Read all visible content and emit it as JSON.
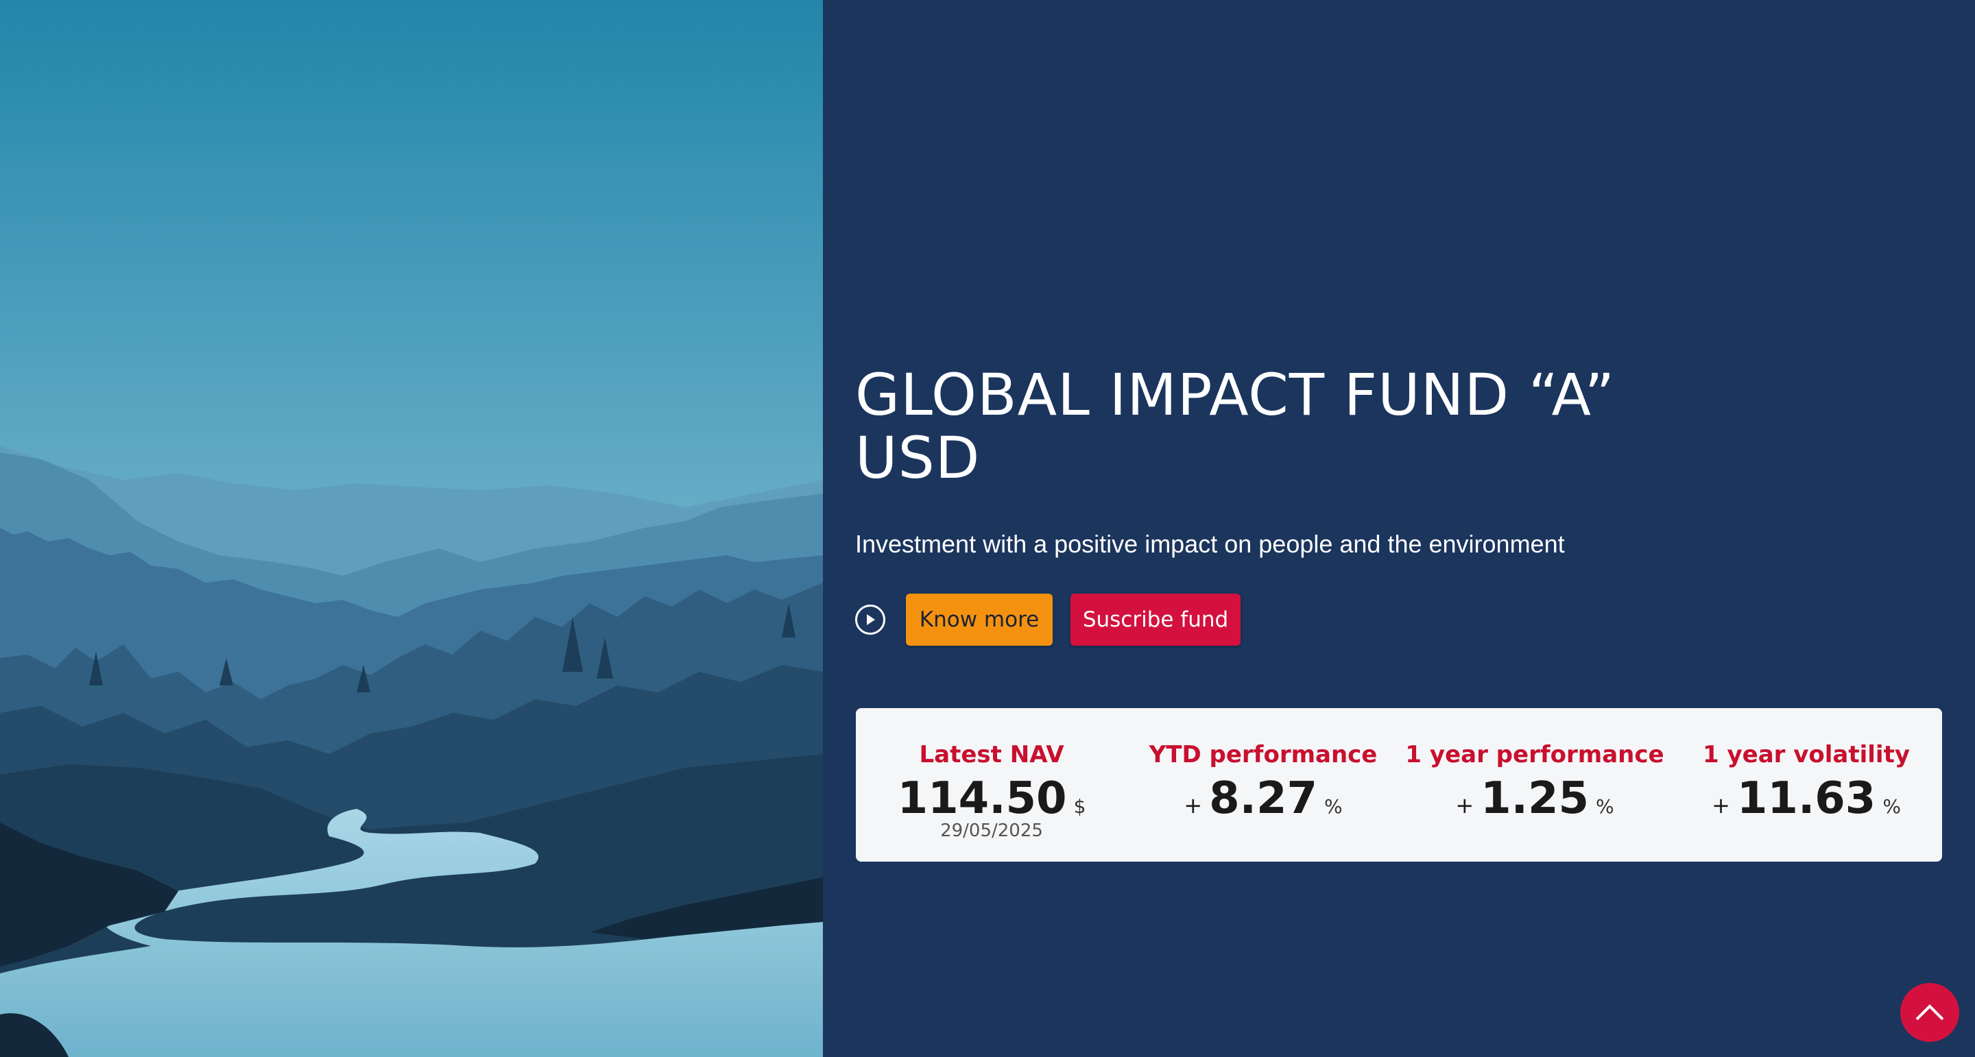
{
  "hero": {
    "title": "GLOBAL IMPACT FUND “A” USD",
    "subtitle": "Investment with a positive impact on people and the environment",
    "play_icon": "play-circle-icon",
    "know_more_label": "Know more",
    "subscribe_label": "Suscribe fund"
  },
  "stats": [
    {
      "label": "Latest NAV",
      "sign": "",
      "value": "114.50",
      "unit": "$",
      "date": "29/05/2025"
    },
    {
      "label": "YTD performance",
      "sign": "+",
      "value": "8.27",
      "unit": "%"
    },
    {
      "label": "1 year performance",
      "sign": "+",
      "value": "1.25",
      "unit": "%"
    },
    {
      "label": "1 year volatility",
      "sign": "+",
      "value": "11.63",
      "unit": "%"
    }
  ],
  "scroll_top_icon": "chevron-up-icon",
  "colors": {
    "background": "#1b355d",
    "accent_orange": "#f4920f",
    "accent_red": "#d4113e",
    "stat_label": "#c8102e",
    "card": "#f5f6f8"
  }
}
